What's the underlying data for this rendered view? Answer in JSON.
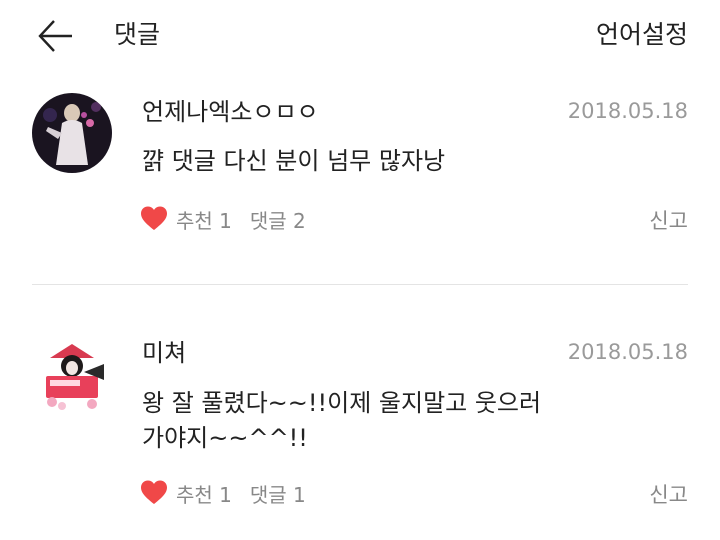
{
  "header": {
    "title": "댓글",
    "language_button": "언어설정",
    "back_icon": "arrow-left-icon"
  },
  "comments": [
    {
      "username": "언제나엑소ㅇㅁㅇ",
      "date": "2018.05.18",
      "text": "꺍 댓글 다신 분이 넘무 많자낭",
      "like_label": "추천 1",
      "reply_label": "댓글 2",
      "report_label": "신고"
    },
    {
      "username": "미쳐",
      "date": "2018.05.18",
      "text_line1": "왕 잘 풀렸다~~!!이제 울지말고 웃으러",
      "text_line2": "가야지~~^^!!",
      "like_label": "추천 1",
      "reply_label": "댓글 1",
      "report_label": "신고"
    }
  ],
  "colors": {
    "heart": "#f04848",
    "muted": "#888888",
    "date": "#9a9a9a"
  }
}
